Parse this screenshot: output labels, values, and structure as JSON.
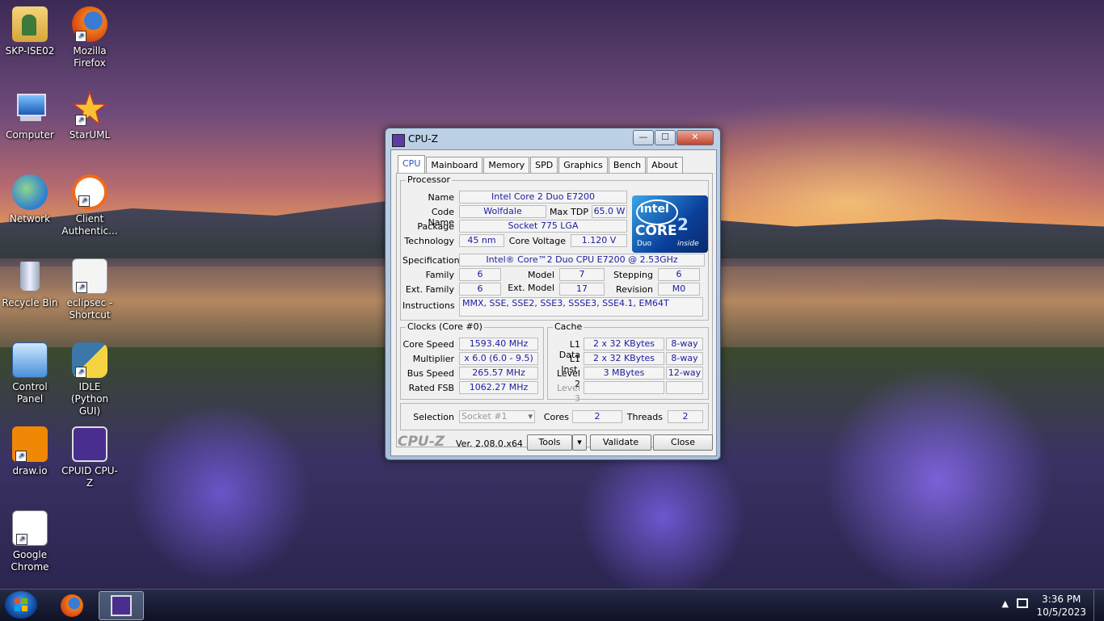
{
  "desktop": {
    "icons": [
      {
        "label": "SKP-ISE02",
        "icon": "user-folder-icon"
      },
      {
        "label": "Mozilla Firefox",
        "icon": "firefox-icon"
      },
      {
        "label": "Computer",
        "icon": "computer-icon"
      },
      {
        "label": "StarUML",
        "icon": "staruml-icon"
      },
      {
        "label": "Network",
        "icon": "network-icon"
      },
      {
        "label": "Client Authentic...",
        "icon": "client-auth-icon"
      },
      {
        "label": "Recycle Bin",
        "icon": "recycle-bin-icon"
      },
      {
        "label": "eclipsec - Shortcut",
        "icon": "eclipse-icon"
      },
      {
        "label": "Control Panel",
        "icon": "control-panel-icon"
      },
      {
        "label": "IDLE (Python GUI)",
        "icon": "python-icon"
      },
      {
        "label": "draw.io",
        "icon": "drawio-icon"
      },
      {
        "label": "CPUID CPU-Z",
        "icon": "cpuz-icon"
      },
      {
        "label": "Google Chrome",
        "icon": "chrome-icon"
      }
    ]
  },
  "window": {
    "title": "CPU-Z",
    "tabs": [
      "CPU",
      "Mainboard",
      "Memory",
      "SPD",
      "Graphics",
      "Bench",
      "About"
    ],
    "processor": {
      "group_label": "Processor",
      "name_label": "Name",
      "name": "Intel Core 2 Duo E7200",
      "codename_label": "Code Name",
      "codename": "Wolfdale",
      "maxtdp_label": "Max TDP",
      "maxtdp": "65.0 W",
      "package_label": "Package",
      "package": "Socket 775 LGA",
      "technology_label": "Technology",
      "technology": "45 nm",
      "corevoltage_label": "Core Voltage",
      "corevoltage": "1.120 V",
      "spec_label": "Specification",
      "spec": "Intel® Core™2 Duo CPU     E7200  @ 2.53GHz",
      "family_label": "Family",
      "family": "6",
      "model_label": "Model",
      "model": "7",
      "stepping_label": "Stepping",
      "stepping": "6",
      "extfamily_label": "Ext. Family",
      "extfamily": "6",
      "extmodel_label": "Ext. Model",
      "extmodel": "17",
      "revision_label": "Revision",
      "revision": "M0",
      "instructions_label": "Instructions",
      "instructions": "MMX, SSE, SSE2, SSE3, SSSE3, SSE4.1, EM64T"
    },
    "logo": {
      "brand": "intel",
      "line": "CORE",
      "sub": "Duo",
      "tag": "inside",
      "num": "2"
    },
    "clocks": {
      "group_label": "Clocks (Core #0)",
      "corespeed_label": "Core Speed",
      "corespeed": "1593.40 MHz",
      "multiplier_label": "Multiplier",
      "multiplier": "x 6.0 (6.0 - 9.5)",
      "busspeed_label": "Bus Speed",
      "busspeed": "265.57 MHz",
      "ratedfsb_label": "Rated FSB",
      "ratedfsb": "1062.27 MHz"
    },
    "cache": {
      "group_label": "Cache",
      "l1data_label": "L1 Data",
      "l1data": "2 x 32 KBytes",
      "l1data_way": "8-way",
      "l1inst_label": "L1 Inst.",
      "l1inst": "2 x 32 KBytes",
      "l1inst_way": "8-way",
      "level2_label": "Level 2",
      "level2": "3 MBytes",
      "level2_way": "12-way",
      "level3_label": "Level 3"
    },
    "selection": {
      "label": "Selection",
      "value": "Socket #1",
      "cores_label": "Cores",
      "cores": "2",
      "threads_label": "Threads",
      "threads": "2"
    },
    "footer": {
      "brand": "CPU-Z",
      "version": "Ver. 2.08.0.x64",
      "tools": "Tools",
      "validate": "Validate",
      "close": "Close"
    }
  },
  "taskbar": {
    "time": "3:36 PM",
    "date": "10/5/2023"
  }
}
